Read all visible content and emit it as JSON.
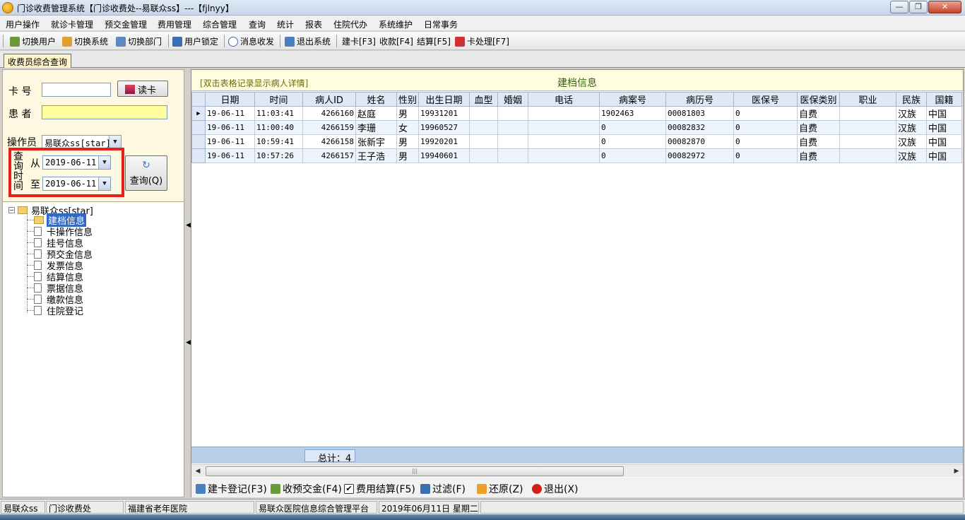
{
  "window": {
    "title": "门诊收费管理系统【门诊收费处--易联众ss】---【fjlnyy】",
    "min_label": "—",
    "max_label": "❐",
    "close_label": "✕"
  },
  "menu": [
    "用户操作",
    "就诊卡管理",
    "预交金管理",
    "费用管理",
    "综合管理",
    "查询",
    "统计",
    "报表",
    "住院代办",
    "系统维护",
    "日常事务"
  ],
  "toolbar": {
    "switch_user": "切换用户",
    "switch_system": "切换系统",
    "switch_dept": "切换部门",
    "lock_user": "用户锁定",
    "messages": "消息收发",
    "exit_system": "退出系统",
    "create_card": "建卡[F3]",
    "collect": "收款[F4]",
    "settle": "结算[F5]",
    "card_process": "卡处理[F7]"
  },
  "doc_tab": "收费员综合查询",
  "left": {
    "card_label": "卡  号",
    "card_value": "",
    "read_card": "读卡",
    "patient_label": "患  者",
    "patient_value": "",
    "operator_label": "操作员",
    "operator_value": "易联众ss[star]",
    "query_time_label": "查询时间",
    "from_label": "从",
    "from_date": "2019-06-11",
    "to_label": "至",
    "to_date": "2019-06-11",
    "query_button": "查询(Q)"
  },
  "tree": {
    "root": "易联众ss[star]",
    "items": [
      "建档信息",
      "卡操作信息",
      "挂号信息",
      "预交金信息",
      "发票信息",
      "结算信息",
      "票据信息",
      "缴款信息",
      "住院登记"
    ],
    "selected": "建档信息"
  },
  "grid": {
    "hint": "[双击表格记录显示病人详情]",
    "title": "建档信息",
    "columns": [
      "日期",
      "时间",
      "病人ID",
      "姓名",
      "性别",
      "出生日期",
      "血型",
      "婚姻",
      "电话",
      "病案号",
      "病历号",
      "医保号",
      "医保类别",
      "职业",
      "民族",
      "国籍"
    ],
    "rows": [
      [
        "19-06-11",
        "11:03:41",
        "4266160",
        "赵庭",
        "男",
        "19931201",
        "",
        "",
        "",
        "1902463",
        "00081803",
        "0",
        "自费",
        "",
        "汉族",
        "中国"
      ],
      [
        "19-06-11",
        "11:00:40",
        "4266159",
        "李珊",
        "女",
        "19960527",
        "",
        "",
        "",
        "0",
        "00082832",
        "0",
        "自费",
        "",
        "汉族",
        "中国"
      ],
      [
        "19-06-11",
        "10:59:41",
        "4266158",
        "张新宇",
        "男",
        "19920201",
        "",
        "",
        "",
        "0",
        "00082870",
        "0",
        "自费",
        "",
        "汉族",
        "中国"
      ],
      [
        "19-06-11",
        "10:57:26",
        "4266157",
        "王子浩",
        "男",
        "19940601",
        "",
        "",
        "",
        "0",
        "00082972",
        "0",
        "自费",
        "",
        "汉族",
        "中国"
      ]
    ],
    "total": "总计：4"
  },
  "actions": {
    "create_record": "建卡登记(F3)",
    "collect_deposit": "收预交金(F4)",
    "fee_settle": "费用结算(F5)",
    "filter": "过滤(F)",
    "restore": "还原(Z)",
    "exit": "退出(X)"
  },
  "status": [
    "易联众ss",
    "门诊收费处",
    "福建省老年医院",
    "易联众医院信息综合管理平台",
    "2019年06月11日 星期二"
  ],
  "colors": {
    "highlight_box": "#e8201b",
    "grid_header": "#dfe8f6",
    "selection": "#316ac5"
  }
}
